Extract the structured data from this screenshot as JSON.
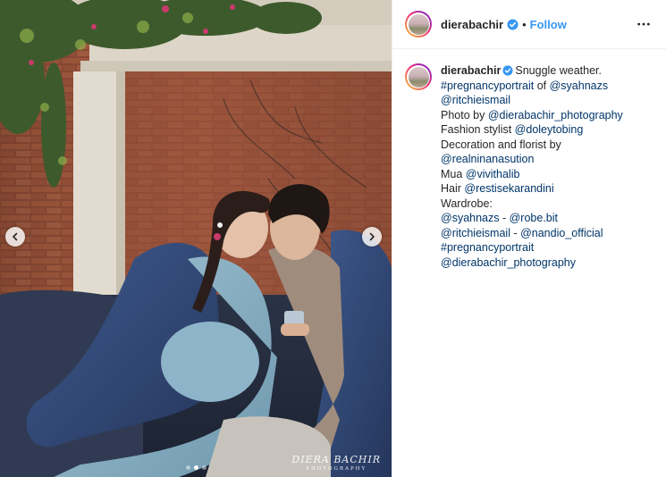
{
  "post": {
    "username": "dierabachir",
    "verified": true,
    "separator": "•",
    "follow_label": "Follow",
    "more_icon": "ellipsis-icon"
  },
  "media": {
    "slide_count": 3,
    "active_slide": 2,
    "watermark_main": "DIERA BACHIR",
    "watermark_sub": "PHOTOGRAPHY",
    "prev_icon": "chevron-left-icon",
    "next_icon": "chevron-right-icon"
  },
  "caption": {
    "username": "dierabachir",
    "lines": [
      [
        {
          "t": "Snuggle weather.",
          "link": false
        }
      ],
      [
        {
          "t": "#pregnancyportrait",
          "link": true
        },
        {
          "t": " of ",
          "link": false
        },
        {
          "t": "@syahnazs",
          "link": true
        }
      ],
      [
        {
          "t": "@ritchieismail",
          "link": true
        }
      ],
      [
        {
          "t": "Photo by ",
          "link": false
        },
        {
          "t": "@dierabachir_photography",
          "link": true
        }
      ],
      [
        {
          "t": "Fashion stylist ",
          "link": false
        },
        {
          "t": "@doleytobing",
          "link": true
        }
      ],
      [
        {
          "t": "Decoration and florist by",
          "link": false
        }
      ],
      [
        {
          "t": "@realninanasution",
          "link": true
        }
      ],
      [
        {
          "t": "Mua ",
          "link": false
        },
        {
          "t": "@vivithalib",
          "link": true
        }
      ],
      [
        {
          "t": "Hair ",
          "link": false
        },
        {
          "t": "@restisekarandini",
          "link": true
        }
      ],
      [
        {
          "t": "Wardrobe:",
          "link": false
        }
      ],
      [
        {
          "t": "@syahnazs",
          "link": true
        },
        {
          "t": " - ",
          "link": false
        },
        {
          "t": "@robe.bit",
          "link": true
        }
      ],
      [
        {
          "t": "@ritchieismail",
          "link": true
        },
        {
          "t": " - ",
          "link": false
        },
        {
          "t": "@nandio_official",
          "link": true
        }
      ],
      [
        {
          "t": "#pregnancyportrait",
          "link": true
        }
      ],
      [
        {
          "t": "@dierabachir_photography",
          "link": true
        }
      ]
    ]
  },
  "colors": {
    "link": "#003569",
    "follow": "#3897f0",
    "verified": "#3897f0",
    "text": "#262626"
  }
}
